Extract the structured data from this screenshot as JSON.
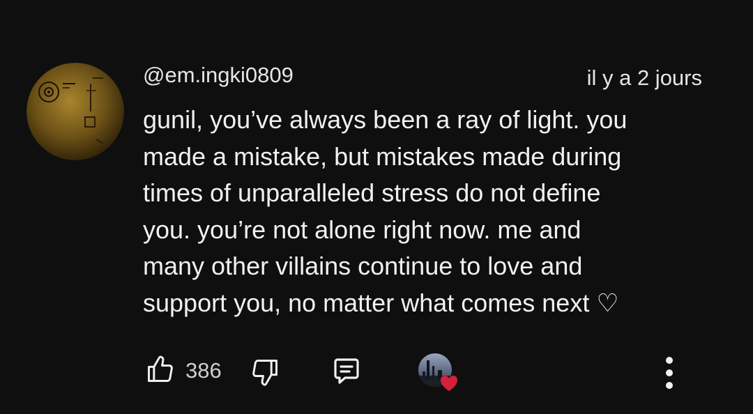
{
  "comment": {
    "author": "@em.ingki0809",
    "timestamp": "il y a 2 jours",
    "lines": [
      "gunil, you’ve always been a ray of light. you",
      "made a mistake, but mistakes made during",
      "times of unparalleled stress do not define",
      "you. you’re not alone right now. me and",
      "many other villains continue to love and",
      "support you, no matter what comes next ♡"
    ]
  },
  "actions": {
    "like_count": "386",
    "icons": {
      "like": "thumbs-up-icon",
      "dislike": "thumbs-down-icon",
      "reply": "reply-comment-icon",
      "creator_heart": "creator-heart-icon",
      "more": "more-vertical-icon"
    }
  },
  "colors": {
    "background": "#0f0f0f",
    "text": "#f1f1f1",
    "heart": "#d4203a"
  }
}
